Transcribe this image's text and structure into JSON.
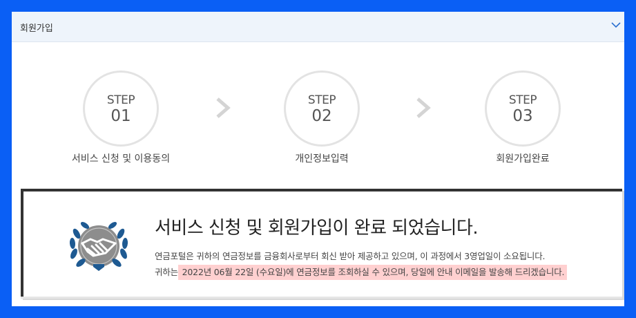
{
  "accordion": {
    "title": "회원가입"
  },
  "steps": [
    {
      "word": "STEP",
      "num": "01",
      "label": "서비스 신청 및 이용동의"
    },
    {
      "word": "STEP",
      "num": "02",
      "label": "개인정보입력"
    },
    {
      "word": "STEP",
      "num": "03",
      "label": "회원가입완료"
    }
  ],
  "result": {
    "headline": "서비스 신청 및 회원가입이 완료 되었습니다.",
    "line1": "연금포털은 귀하의 연금정보를 금융회사로부터 회신 받아 제공하고 있으며, 이 과정에서 3영업일이 소요됩니다.",
    "line2_prefix": "귀하는",
    "line2_highlight": " 2022년 06월 22일 (수요일)에 연금정보를 조회하실 수 있으며, 당일에 안내 이메일을 발송해 드리겠습니다."
  },
  "icons": {
    "chevron": "chevron-down-icon",
    "arrow": "chevron-right-icon",
    "badge": "handshake-laurel-icon"
  },
  "colors": {
    "frame_border": "#0a5ff5",
    "header_bg": "#eef4fb",
    "highlight": "#ffd0d0",
    "laurel": "#1e5a92"
  }
}
